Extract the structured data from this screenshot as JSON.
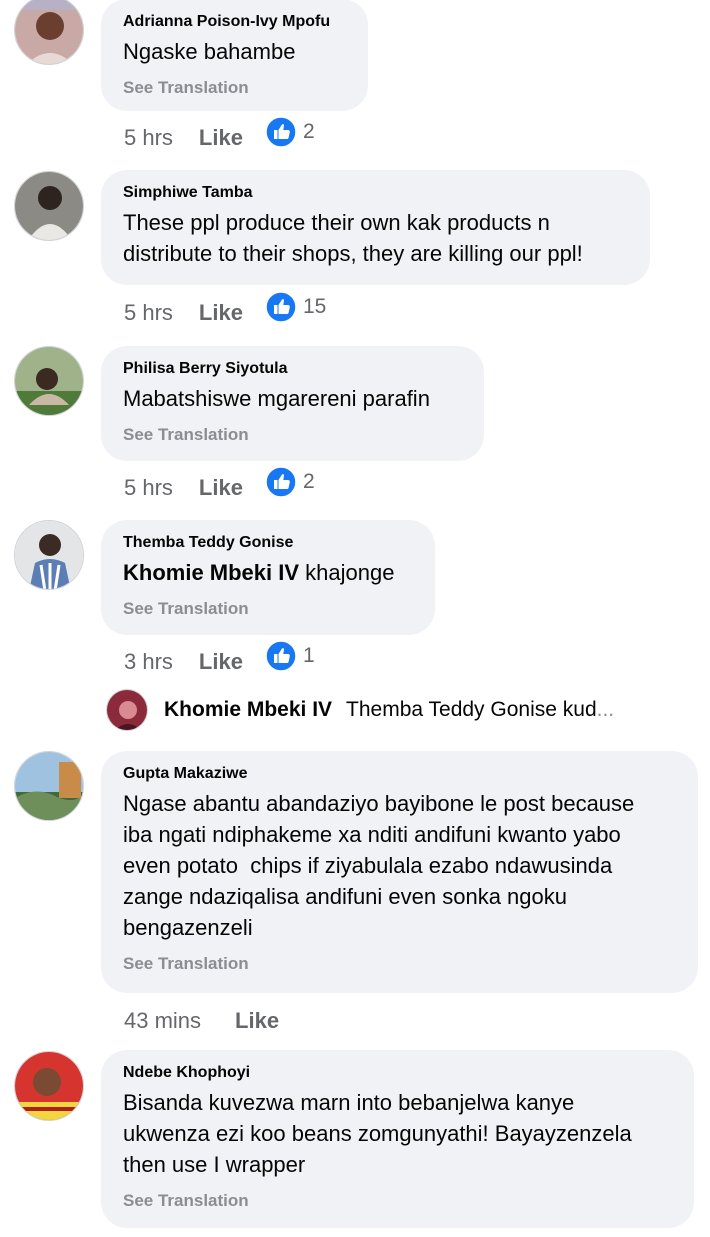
{
  "comments": [
    {
      "author": "Adrianna Poison-Ivy Mpofu",
      "text": "Ngaske bahambe",
      "see_translation": "See Translation",
      "time": "5 hrs",
      "like_label": "Like",
      "reactions": "2",
      "avatar_icon": "woman-photo-avatar"
    },
    {
      "author": "Simphiwe Tamba",
      "text": "These ppl produce their own kak products n\ndistribute to their shops, they are killing our ppl!",
      "time": "5 hrs",
      "like_label": "Like",
      "reactions": "15",
      "avatar_icon": "man-photo-avatar"
    },
    {
      "author": "Philisa Berry Siyotula",
      "text": "Mabatshiswe mgarereni parafin",
      "see_translation": "See Translation",
      "time": "5 hrs",
      "like_label": "Like",
      "reactions": "2",
      "avatar_icon": "outdoor-photo-avatar"
    },
    {
      "author": "Themba Teddy Gonise",
      "mention": "Khomie Mbeki IV",
      "text": " khajonge",
      "see_translation": "See Translation",
      "time": "3 hrs",
      "like_label": "Like",
      "reactions": "1",
      "avatar_icon": "man-photo-avatar"
    },
    {
      "author": "Gupta Makaziwe",
      "text": "Ngase abantu abandaziyo bayibone le post because\niba ngati ndiphakeme xa nditi andifuni kwanto yabo\neven potato  chips if ziyabulala ezabo ndawusinda\nzange ndaziqalisa andifuni even sonka ngoku\nbengazenzeli",
      "see_translation": "See Translation",
      "time": "43 mins",
      "like_label": "Like",
      "avatar_icon": "landscape-photo-avatar"
    },
    {
      "author": "Ndebe Khophoyi",
      "text": "Bisanda kuvezwa marn into bebanjelwa kanye\nukwenza ezi koo beans zomgunyathi! Bayayzenzela\nthen use I wrapper",
      "see_translation": "See Translation",
      "avatar_icon": "person-photo-avatar"
    }
  ],
  "reply": {
    "author": "Khomie Mbeki IV",
    "text": "Themba Teddy Gonise  kud",
    "more": "..."
  },
  "colors": {
    "bubble": "#f0f2f5",
    "secondary_text": "#65676b",
    "like_blue": "#1877f2"
  }
}
